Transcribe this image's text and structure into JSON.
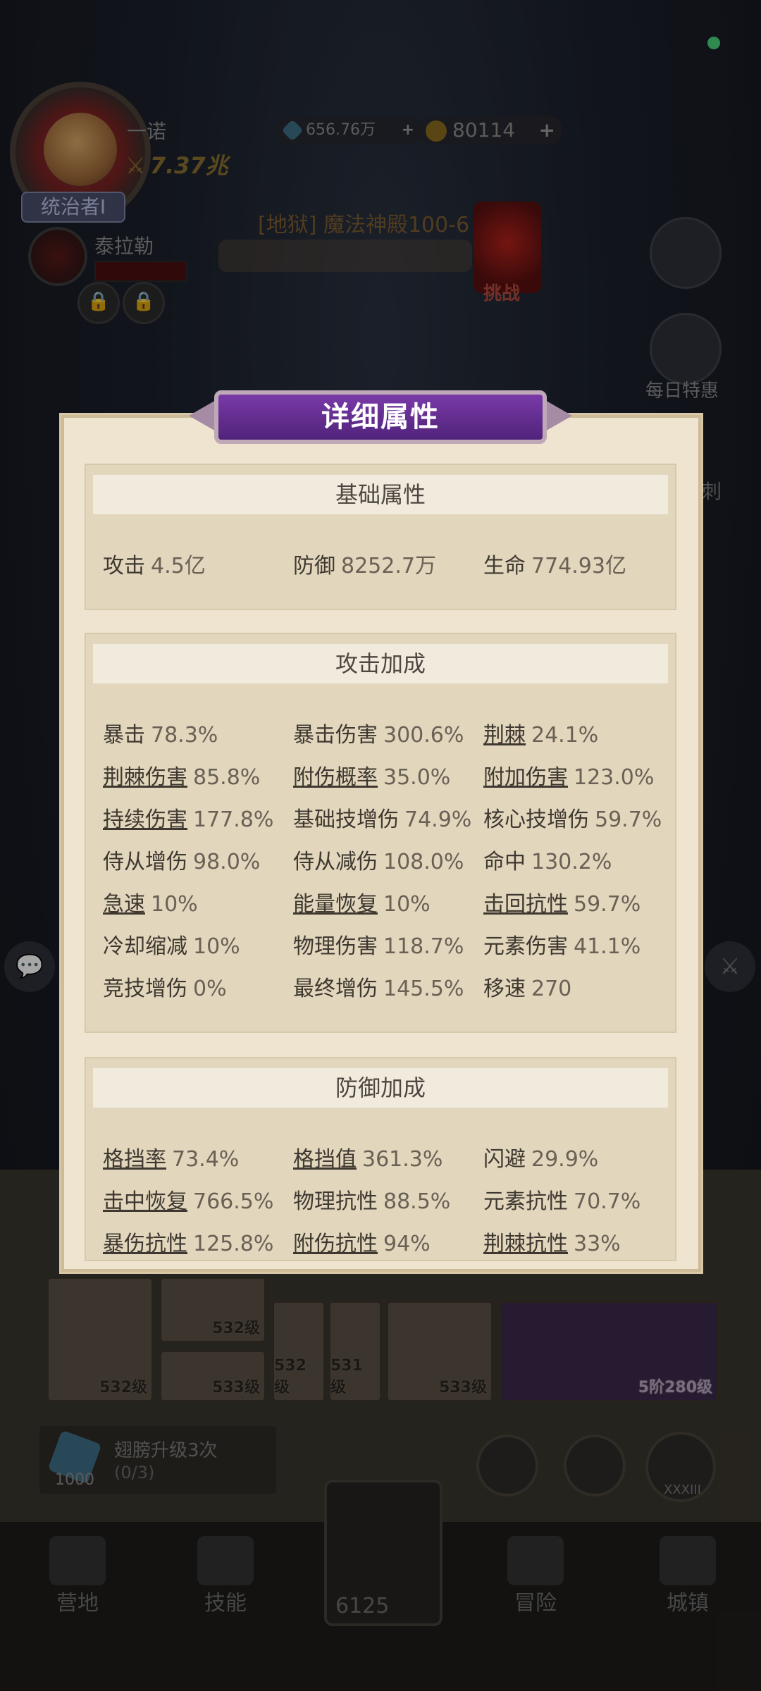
{
  "hud": {
    "player_name": "一诺",
    "power": "7.37兆",
    "rank": "统治者Ⅰ",
    "gems": "656.76万",
    "gold": "80114",
    "pet_name": "泰拉勒",
    "stage": "[地狱] 魔法神殿100-6",
    "challenge": "挑战",
    "daily_deals": "每日特惠",
    "side_partial": "刺"
  },
  "panel": {
    "title": "详细属性",
    "base": {
      "header": "基础属性",
      "stats": [
        {
          "label": "攻击",
          "value": "4.5亿"
        },
        {
          "label": "防御",
          "value": "8252.7万"
        },
        {
          "label": "生命",
          "value": "774.93亿"
        }
      ]
    },
    "attack": {
      "header": "攻击加成",
      "stats": [
        {
          "label": "暴击",
          "value": "78.3%"
        },
        {
          "label": "暴击伤害",
          "value": "300.6%"
        },
        {
          "label": "荆棘",
          "value": "24.1%"
        },
        {
          "label": "荆棘伤害",
          "value": "85.8%"
        },
        {
          "label": "附伤概率",
          "value": "35.0%"
        },
        {
          "label": "附加伤害",
          "value": "123.0%"
        },
        {
          "label": "持续伤害",
          "value": "177.8%"
        },
        {
          "label": "基础技增伤",
          "value": "74.9%"
        },
        {
          "label": "核心技增伤",
          "value": "59.7%"
        },
        {
          "label": "侍从增伤",
          "value": "98.0%"
        },
        {
          "label": "侍从减伤",
          "value": "108.0%"
        },
        {
          "label": "命中",
          "value": "130.2%"
        },
        {
          "label": "急速",
          "value": "10%"
        },
        {
          "label": "能量恢复",
          "value": "10%"
        },
        {
          "label": "击回抗性",
          "value": "59.7%"
        },
        {
          "label": "冷却缩减",
          "value": "10%"
        },
        {
          "label": "物理伤害",
          "value": "118.7%"
        },
        {
          "label": "元素伤害",
          "value": "41.1%"
        },
        {
          "label": "竞技增伤",
          "value": "0%"
        },
        {
          "label": "最终增伤",
          "value": "145.5%"
        },
        {
          "label": "移速",
          "value": "270"
        }
      ]
    },
    "defense": {
      "header": "防御加成",
      "stats": [
        {
          "label": "格挡率",
          "value": "73.4%"
        },
        {
          "label": "格挡值",
          "value": "361.3%"
        },
        {
          "label": "闪避",
          "value": "29.9%"
        },
        {
          "label": "击中恢复",
          "value": "766.5%"
        },
        {
          "label": "物理抗性",
          "value": "88.5%"
        },
        {
          "label": "元素抗性",
          "value": "70.7%"
        },
        {
          "label": "暴伤抗性",
          "value": "125.8%"
        },
        {
          "label": "附伤抗性",
          "value": "94%"
        },
        {
          "label": "荆棘抗性",
          "value": "33%"
        }
      ]
    }
  },
  "inventory": {
    "levels": [
      "532级",
      "532级",
      "533级",
      "532级",
      "531级",
      "533级",
      "5阶280级"
    ]
  },
  "quest": {
    "title": "翅膀升级3次",
    "progress": "(0/3)",
    "count": "1000"
  },
  "roman": "XXXIII",
  "nav": {
    "camp": "营地",
    "skills": "技能",
    "center_value": "6125",
    "adventure": "冒险",
    "town": "城镇"
  }
}
